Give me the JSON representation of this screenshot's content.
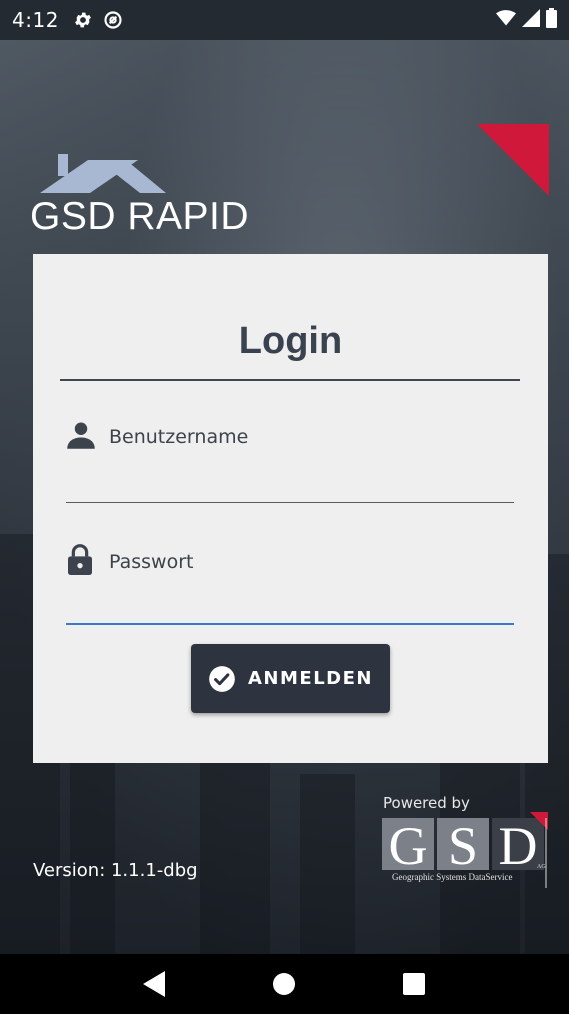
{
  "status_bar": {
    "time": "4:12",
    "icons": [
      "settings-icon",
      "sync-icon",
      "wifi-icon",
      "signal-icon",
      "battery-icon"
    ]
  },
  "branding": {
    "app_name": "GSD RAPID",
    "accent_color": "#d0183a"
  },
  "login": {
    "title": "Login",
    "username_placeholder": "Benutzername",
    "password_placeholder": "Passwort",
    "submit_label": "ANMELDEN",
    "icons": [
      "person-icon",
      "lock-icon",
      "check-circle-icon"
    ]
  },
  "footer": {
    "version": "Version: 1.1.1-dbg",
    "powered_by": "Powered by",
    "gsd_company": "Geographic Systems DataService"
  },
  "nav": {
    "icons": [
      "back-icon",
      "home-icon",
      "recents-icon"
    ]
  },
  "colors": {
    "card_bg": "#efefef",
    "button_bg": "#2d3440",
    "active_underline": "#3b78d0",
    "text_dark": "#3a4250"
  }
}
